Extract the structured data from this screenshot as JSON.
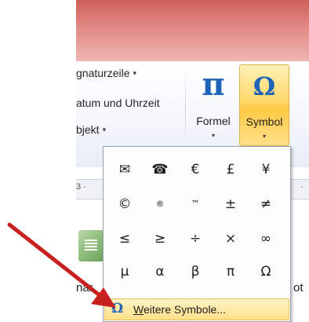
{
  "ribbon": {
    "insert_items": [
      {
        "label": "gnaturzeile",
        "has_dropdown": true
      },
      {
        "label": "atum und Uhrzeit",
        "has_dropdown": false
      },
      {
        "label": "bjekt",
        "has_dropdown": true
      }
    ],
    "formula_button": {
      "glyph": "π",
      "label": "Formel"
    },
    "symbol_button": {
      "glyph": "Ω",
      "label": "Symbol"
    }
  },
  "document": {
    "ruler_left": "3 ·",
    "ruler_right": "·",
    "text_left": "nar",
    "text_right": "ot"
  },
  "symbol_menu": {
    "rows": [
      [
        "✉",
        "☎",
        "€",
        "£",
        "¥"
      ],
      [
        "©",
        "®",
        "™",
        "±",
        "≠"
      ],
      [
        "≤",
        "≥",
        "÷",
        "×",
        "∞"
      ],
      [
        "µ",
        "α",
        "β",
        "π",
        "Ω"
      ]
    ],
    "more_symbols": {
      "icon": "Ω",
      "accelerator": "W",
      "label_rest": "eitere Symbole..."
    }
  },
  "colors": {
    "accent_blue": "#1e63b8",
    "hover_gold": "#fec945",
    "annotation_arrow": "#c8201e"
  }
}
